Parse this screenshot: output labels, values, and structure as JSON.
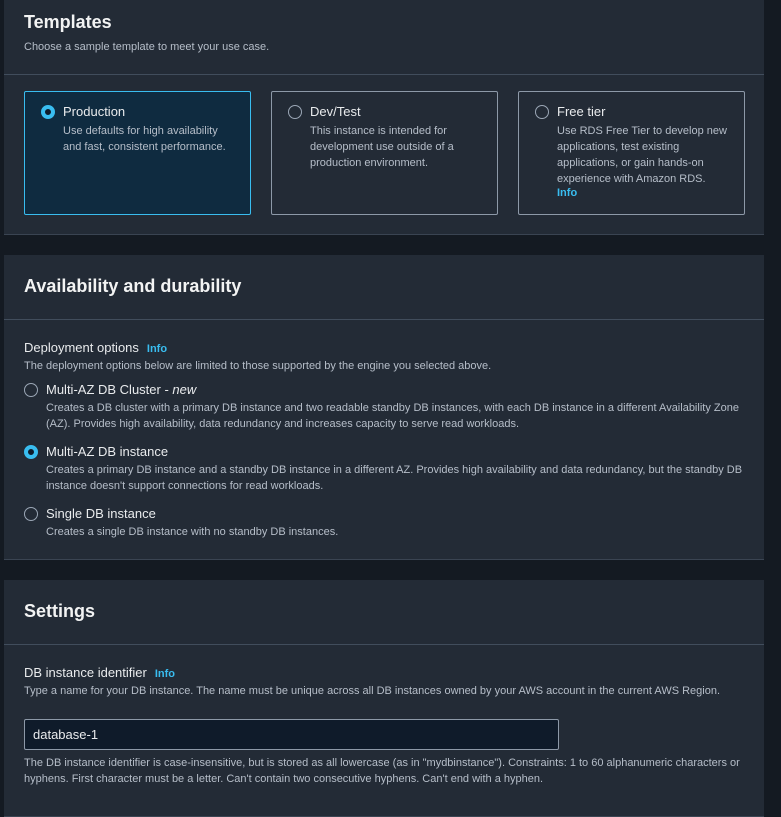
{
  "templates": {
    "title": "Templates",
    "description": "Choose a sample template to meet your use case.",
    "options": [
      {
        "title": "Production",
        "description": "Use defaults for high availability and fast, consistent performance.",
        "selected": true
      },
      {
        "title": "Dev/Test",
        "description": "This instance is intended for development use outside of a production environment.",
        "selected": false
      },
      {
        "title": "Free tier",
        "description": "Use RDS Free Tier to develop new applications, test existing applications, or gain hands-on experience with Amazon RDS.",
        "info": "Info",
        "selected": false
      }
    ]
  },
  "availability": {
    "title": "Availability and durability",
    "deployment_label": "Deployment options",
    "info": "Info",
    "deployment_description": "The deployment options below are limited to those supported by the engine you selected above.",
    "options": [
      {
        "title": "Multi-AZ DB Cluster - ",
        "title_suffix": "new",
        "description": "Creates a DB cluster with a primary DB instance and two readable standby DB instances, with each DB instance in a different Availability Zone (AZ). Provides high availability, data redundancy and increases capacity to serve read workloads.",
        "selected": false
      },
      {
        "title": "Multi-AZ DB instance",
        "description": "Creates a primary DB instance and a standby DB instance in a different AZ. Provides high availability and data redundancy, but the standby DB instance doesn't support connections for read workloads.",
        "selected": true
      },
      {
        "title": "Single DB instance",
        "description": "Creates a single DB instance with no standby DB instances.",
        "selected": false
      }
    ]
  },
  "settings": {
    "title": "Settings",
    "identifier_label": "DB instance identifier",
    "info": "Info",
    "identifier_description": "Type a name for your DB instance. The name must be unique across all DB instances owned by your AWS account in the current AWS Region.",
    "identifier_value": "database-1",
    "identifier_constraints": "The DB instance identifier is case-insensitive, but is stored as all lowercase (as in \"mydbinstance\"). Constraints: 1 to 60 alphanumeric characters or hyphens. First character must be a letter. Can't contain two consecutive hyphens. Can't end with a hyphen."
  },
  "colors": {
    "accent": "#39bdf0",
    "panel": "#232b36",
    "selected_tile": "#0f2b40"
  }
}
